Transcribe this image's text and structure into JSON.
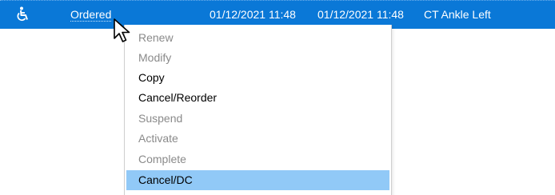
{
  "order_row": {
    "icon": "wheelchair-icon",
    "status": "Ordered",
    "date_1": "01/12/2021 11:48",
    "date_2": "01/12/2021 11:48",
    "description": "CT Ankle Left",
    "background": "#0a78d7",
    "text_color": "#ffffff"
  },
  "context_menu": {
    "items": [
      {
        "label": "Renew",
        "enabled": false
      },
      {
        "label": "Modify",
        "enabled": false
      },
      {
        "label": "Copy",
        "enabled": true
      },
      {
        "label": "Cancel/Reorder",
        "enabled": true
      },
      {
        "label": "Suspend",
        "enabled": false
      },
      {
        "label": "Activate",
        "enabled": false
      },
      {
        "label": "Complete",
        "enabled": false
      },
      {
        "label": "Cancel/DC",
        "enabled": true,
        "highlighted": true
      }
    ],
    "disabled_color": "#8a8a8a",
    "highlight_color": "#91c9f7"
  },
  "cursor": {
    "icon": "arrow-cursor-icon"
  }
}
